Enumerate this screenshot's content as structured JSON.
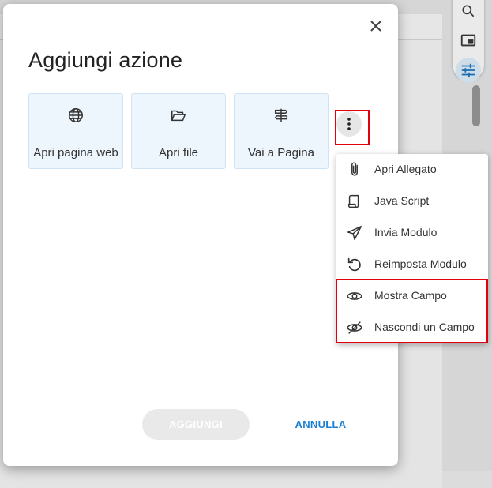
{
  "dialog": {
    "title": "Aggiungi azione",
    "cards": [
      {
        "label": "Apri pagina web",
        "icon": "globe-icon"
      },
      {
        "label": "Apri file",
        "icon": "folder-open-icon"
      },
      {
        "label": "Vai a Pagina",
        "icon": "signpost-icon"
      }
    ],
    "more_icon": "more-vertical-icon",
    "close_icon": "close-icon",
    "add_label": "AGGIUNGI",
    "cancel_label": "ANNULLA"
  },
  "menu": {
    "items": [
      {
        "label": "Apri Allegato",
        "icon": "paperclip-icon"
      },
      {
        "label": "Java Script",
        "icon": "script-icon"
      },
      {
        "label": "Invia Modulo",
        "icon": "send-icon"
      },
      {
        "label": "Reimposta Modulo",
        "icon": "reset-icon"
      },
      {
        "label": "Mostra Campo",
        "icon": "eye-icon"
      },
      {
        "label": "Nascondi un Campo",
        "icon": "eye-off-icon"
      }
    ]
  },
  "colors": {
    "accent": "#1a7fd0",
    "highlight": "#e2000f",
    "card_bg": "#eef6fd"
  }
}
